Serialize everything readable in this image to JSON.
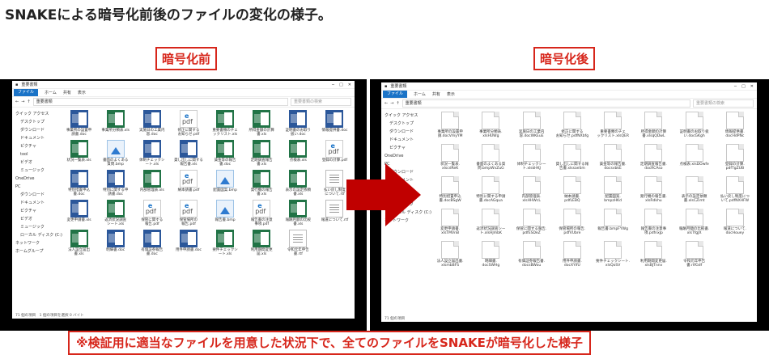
{
  "title": "SNAKEによる暗号化前後のファイルの変化の様子。",
  "label_before": "暗号化前",
  "label_after": "暗号化後",
  "banner": "※検証用に適当なファイルを用意した状況下で、全てのファイルをSNAKEが暗号化した様子",
  "before": {
    "folder": "重要書類",
    "ribbon": [
      "ファイル",
      "ホーム",
      "共有",
      "表示"
    ],
    "search": "重要書類の検索",
    "nav": [
      "クイック アクセス",
      "デスクトップ",
      "ダウンロード",
      "ドキュメント",
      "ピクチャ",
      "tool",
      "ビデオ",
      "ミュージック",
      "OneDrive",
      "PC",
      "ダウンロード",
      "ドキュメント",
      "ピクチャ",
      "ビデオ",
      "ミュージック",
      "ローカル ディスク (C:)",
      "ネットワーク",
      "ホームグループ"
    ],
    "status": "71 個の項目　1 個の項目を選択 0 バイト",
    "files": [
      {
        "t": "word",
        "n": "事業所の設置申\n請書.doc"
      },
      {
        "t": "excel",
        "n": "事業所分類表.xls"
      },
      {
        "t": "word",
        "n": "実施日の工業内\n容.doc"
      },
      {
        "t": "pdf",
        "n": "修正に関する\nお知らせ.pdf"
      },
      {
        "t": "excel",
        "n": "重要書類のチェ\nックリスト.xls"
      },
      {
        "t": "excel",
        "n": "所得金額の計算\n書.xls"
      },
      {
        "t": "word",
        "n": "証明書のお取り\n扱い.doc"
      },
      {
        "t": "word",
        "n": "情報提供書.doc"
      },
      {
        "t": "excel",
        "n": "状況一覧表.xls"
      },
      {
        "t": "img",
        "n": "書面のよくある\n質問.bmp"
      },
      {
        "t": "word",
        "n": "体制チェックシ\nート.xls"
      },
      {
        "t": "word",
        "n": "貸し出しに関する\n報告書.xls"
      },
      {
        "t": "excel",
        "n": "賃金等の報告\n書.doc"
      },
      {
        "t": "excel",
        "n": "定期調査報告\n書.xls"
      },
      {
        "t": "excel",
        "n": "点検表.xls"
      },
      {
        "t": "pdf",
        "n": "登録の計算.pdf"
      },
      {
        "t": "word",
        "n": "特別措置申込\n書.doc"
      },
      {
        "t": "word",
        "n": "特別に関する申\n請書.doc"
      },
      {
        "t": "excel",
        "n": "内部管理表.xls"
      },
      {
        "t": "pdf",
        "n": "納本請書.pdf"
      },
      {
        "t": "img",
        "n": "配置図案.bmp"
      },
      {
        "t": "excel",
        "n": "発行機の報告\n書.xls"
      },
      {
        "t": "excel",
        "n": "表示の設定依頼\n書.xls"
      },
      {
        "t": "txt",
        "n": "払い戻し制度\nについて.rtf"
      },
      {
        "t": "word",
        "n": "変更申請書.xls"
      },
      {
        "t": "excel",
        "n": "返済状況調査\nシート.xls"
      },
      {
        "t": "pdf",
        "n": "保管に関する\n報告.pdf"
      },
      {
        "t": "pdf",
        "n": "保管場所の\n報告.pdf"
      },
      {
        "t": "img",
        "n": "報告書.bmp"
      },
      {
        "t": "pdf",
        "n": "報告書の注意\n事項.pdf"
      },
      {
        "t": "excel",
        "n": "報酬月額の比較\n書.xls"
      },
      {
        "t": "txt",
        "n": "報道について.rtf"
      },
      {
        "t": "excel",
        "n": "法人設立届出\n書.xls"
      },
      {
        "t": "word",
        "n": "明細書.doc"
      },
      {
        "t": "word",
        "n": "有価証券報告\n書.doc"
      },
      {
        "t": "word",
        "n": "用件申請書.doc"
      },
      {
        "t": "excel",
        "n": "要件チェックシ\nート.xls"
      },
      {
        "t": "excel",
        "n": "利用期間変更\n届.xls"
      },
      {
        "t": "txt",
        "n": "令和元年申告\n書.rtf"
      }
    ]
  },
  "after": {
    "folder": "重要書類",
    "ribbon": [
      "ファイル",
      "ホーム",
      "共有",
      "表示"
    ],
    "search": "重要書類の検索",
    "nav": [
      "クイック アクセス",
      "デスクトップ",
      "ダウンロード",
      "ドキュメント",
      "ピクチャ",
      "OneDrive",
      "PC",
      "ダウンロード",
      "ドキュメント",
      "ピクチャ",
      "ビデオ",
      "ミュージック",
      "ローカル ディスク (C:)",
      "ネットワーク"
    ],
    "status": "71 個の項目",
    "files": [
      "事業所の設置申\n請.docVmyYM",
      "事業所分類表.\nxlsHUWg",
      "実施日の工業内\n容.docWKEuE",
      "修正に関する\nお知らせ.pdfNXbfg",
      "重要書類のチェ\nックリスト.xlsQER",
      "所得金額の計算\n書.xlsqQDwL",
      "証明書のお取り扱\nい.docGKgh",
      "情報提供書.\ndocHdPNc",
      "状況一覧表.\nxlscdReK",
      "書面のよくある質\n問.bmpWvZuG",
      "体制チェックシー\nト.xlskHKJ",
      "貸し出しに関する報\n告書.xlssaeSm",
      "賃金等の報告書.\ndocsvbkE",
      "定期調査報告書.\ndocRCAso",
      "点検表.xlsDOwfe",
      "登録の計算.\npdfTgZUB",
      "特別措置申込\n書.docBSgW",
      "特別に関する申請\n書.docAGqua",
      "内部管理表.\nxlsHHWcL",
      "納本請書.\npdfLEBQ",
      "配置図案.\nbmpzHKd",
      "発行機の報告書.\nxlsRdkhu",
      "表示の設定依頼\n書.xlsCZimt",
      "払い戻し制度につ\nいて.pdfNXHFW",
      "変更申請書.\nxlsTMVnB",
      "返済状況調査シー\nト.xlsHJmbK",
      "保管に関する報告.\npdfESDeZ",
      "保管場所の報告.\npdfVUbre",
      "報告書.bmpFYWg",
      "報告書の注意事\n項.pdfnxJp",
      "報酬月額の比較書.\nxlsTfgJX",
      "報道について.\ndocHouey",
      "法人設立届出書.\nxlsmbBFS",
      "明細書.\ndocSWHg",
      "有価証券報告書.\ndocsBWou",
      "用件申請書.\ndocXYifU",
      "要件チェックシート.\nxlsQoSV",
      "利用期間変更届.\nxlsBJTnnv",
      "令和元年申告\n書.rtfGdf"
    ]
  }
}
